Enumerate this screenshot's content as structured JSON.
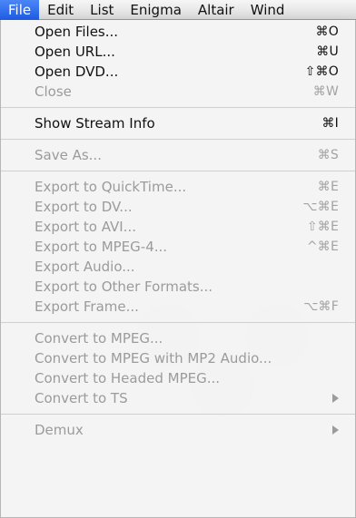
{
  "menubar": {
    "items": [
      {
        "label": "File",
        "active": true
      },
      {
        "label": "Edit",
        "active": false
      },
      {
        "label": "List",
        "active": false
      },
      {
        "label": "Enigma",
        "active": false
      },
      {
        "label": "Altair",
        "active": false
      },
      {
        "label": "Wind",
        "active": false
      }
    ]
  },
  "menu": {
    "sections": [
      {
        "items": [
          {
            "label": "Open Files...",
            "shortcut": "⌘O",
            "enabled": true
          },
          {
            "label": "Open URL...",
            "shortcut": "⌘U",
            "enabled": true
          },
          {
            "label": "Open DVD...",
            "shortcut": "⇧⌘O",
            "enabled": true
          },
          {
            "label": "Close",
            "shortcut": "⌘W",
            "enabled": false
          }
        ]
      },
      {
        "items": [
          {
            "label": "Show Stream Info",
            "shortcut": "⌘I",
            "enabled": true
          }
        ]
      },
      {
        "items": [
          {
            "label": "Save As...",
            "shortcut": "⌘S",
            "enabled": false
          }
        ]
      },
      {
        "items": [
          {
            "label": "Export to QuickTime...",
            "shortcut": "⌘E",
            "enabled": false
          },
          {
            "label": "Export to DV...",
            "shortcut": "⌥⌘E",
            "enabled": false
          },
          {
            "label": "Export to AVI...",
            "shortcut": "⇧⌘E",
            "enabled": false
          },
          {
            "label": "Export to MPEG-4...",
            "shortcut": "^⌘E",
            "enabled": false
          },
          {
            "label": "Export Audio...",
            "shortcut": "",
            "enabled": false
          },
          {
            "label": "Export to Other Formats...",
            "shortcut": "",
            "enabled": false
          },
          {
            "label": "Export Frame...",
            "shortcut": "⌥⌘F",
            "enabled": false
          }
        ]
      },
      {
        "items": [
          {
            "label": "Convert to MPEG...",
            "shortcut": "",
            "enabled": false
          },
          {
            "label": "Convert to MPEG with MP2 Audio...",
            "shortcut": "",
            "enabled": false
          },
          {
            "label": "Convert to Headed MPEG...",
            "shortcut": "",
            "enabled": false
          },
          {
            "label": "Convert to TS",
            "shortcut": "",
            "enabled": false,
            "has_submenu": true
          }
        ]
      },
      {
        "items": [
          {
            "label": "Demux",
            "shortcut": "",
            "enabled": false,
            "has_submenu": true
          }
        ]
      }
    ]
  },
  "colors": {
    "menubar_active_top": "#4b86f7",
    "menubar_active_bottom": "#1f5ee7",
    "menu_text": "#111111",
    "menu_text_disabled": "#9b9b9b",
    "separator": "#cfcfcf"
  }
}
